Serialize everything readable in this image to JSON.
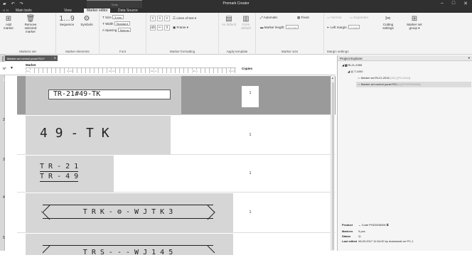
{
  "app": {
    "title": "Promark Creator",
    "context_tab_group": "Tools",
    "window_controls": [
      "–",
      "□",
      "✕"
    ]
  },
  "quick_access": [
    "▰",
    "↶",
    "↷"
  ],
  "tabs": [
    "Main tools",
    "View",
    "Marker editor",
    "Data Source"
  ],
  "active_tab": "Marker editor",
  "ribbon": {
    "markers_set": {
      "label": "Markers set",
      "add": "Add marker",
      "remove": "Remove selected marker"
    },
    "marker_elements": {
      "label": "Marker elements",
      "sequence": "Sequence",
      "symbols": "Symbols"
    },
    "font": {
      "label": "Font",
      "size_label": "Size",
      "size_value": "3 mm",
      "width_label": "Width",
      "width_value": "Standard",
      "spacing_label": "Spacing",
      "spacing_value": "Narrow"
    },
    "marker_formatting": {
      "label": "Marker formatting",
      "lines_of_text": "Lines of text",
      "frame": "Frame"
    },
    "apply_template": {
      "label": "Apply template",
      "as_default": "As default",
      "from_default": "From default"
    },
    "marker_size": {
      "label": "Marker size",
      "automatic": "Automatic",
      "fixed": "Fixed",
      "marker_length": "Marker length:",
      "marker_length_value": "10 mm"
    },
    "margin_settings": {
      "label": "Margin settings",
      "normal": "Normal",
      "expanded": "Expanded",
      "left_margin": "Left margin:",
      "left_margin_value": "2 mm",
      "cutting_settings": "Cutting settings",
      "marker_set_group": "Marker set group"
    }
  },
  "status_panel": "Element status",
  "document_tab": "Marker set control panel R21*",
  "grid": {
    "nr_header": "Nº",
    "marker_header": "Marker",
    "ruler": [
      "0mm",
      "10mm",
      "20mm",
      "30mm",
      "40mm",
      "50mm"
    ],
    "copies_header": "Copies",
    "rows": [
      {
        "nr": "1",
        "text": "TR-21#49-TK",
        "copies": "1"
      },
      {
        "nr": "2",
        "text": "4 9 - T K",
        "copies": "1"
      },
      {
        "nr": "3",
        "line1": "T R - 2 1",
        "line2": "T R - 4 9",
        "copies": "1"
      },
      {
        "nr": "4",
        "text": "T R K - ⚙ - W J T K 3",
        "copies": "1"
      },
      {
        "nr": "5",
        "text": "T R S - - - W J 1 4 5",
        "copies": ""
      }
    ]
  },
  "project_explorer": {
    "title": "Project Explorer",
    "tree": [
      {
        "label": "RL21-2355",
        "extra": ""
      },
      {
        "label": "T-1000",
        "extra": ""
      },
      {
        "label": "Marker set RL21-2016",
        "extra": "[101] [PO-0344]"
      },
      {
        "label": "Marker set control panel R21",
        "extra": "[6] [PH22006494]"
      }
    ]
  },
  "properties": {
    "product_label": "Product",
    "product_value": "Code PH22006494",
    "markers_label": "Markers",
    "markers_value": "5 pcs",
    "status_label": "Status",
    "status_value": "◎",
    "last_edited_label": "Last edited",
    "last_edited_value": "06.03.2017 11:54:20 by dvadowski on PC-1"
  }
}
